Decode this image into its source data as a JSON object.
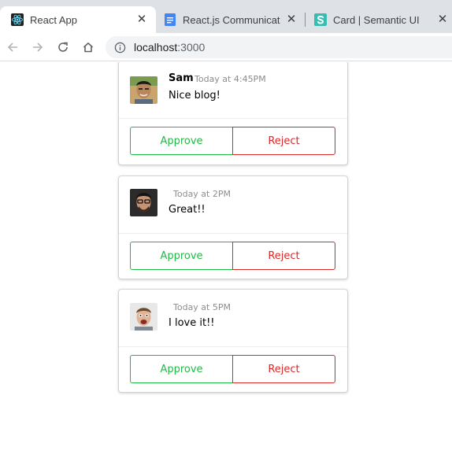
{
  "browser": {
    "tabs": [
      {
        "title": "React App",
        "active": true,
        "icon": "react-icon"
      },
      {
        "title": "React.js Communicatin",
        "active": false,
        "icon": "google-docs-icon"
      },
      {
        "title": "Card | Semantic UI",
        "active": false,
        "icon": "semantic-ui-icon"
      }
    ],
    "close_glyph": "✕",
    "url_host": "localhost",
    "url_port": ":3000"
  },
  "colors": {
    "approve": "#21ba45",
    "reject": "#db2828"
  },
  "comments": [
    {
      "author": "Sam",
      "time": "Today at 4:45PM",
      "text": "Nice blog!",
      "approve_label": "Approve",
      "reject_label": "Reject"
    },
    {
      "author": "",
      "time": "Today at 2PM",
      "text": "Great!!",
      "approve_label": "Approve",
      "reject_label": "Reject"
    },
    {
      "author": "",
      "time": "Today at 5PM",
      "text": "I love it!!",
      "approve_label": "Approve",
      "reject_label": "Reject"
    }
  ]
}
